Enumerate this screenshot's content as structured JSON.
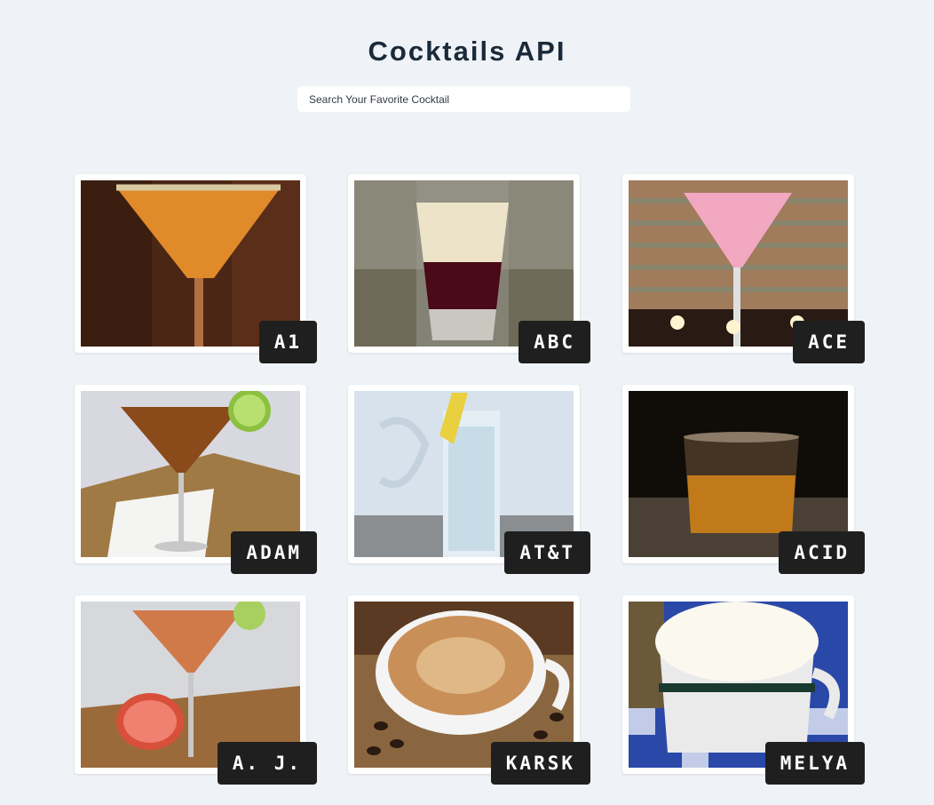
{
  "header": {
    "title": "Cocktails API"
  },
  "search": {
    "placeholder": "Search Your Favorite Cocktail",
    "value": ""
  },
  "cocktails": [
    {
      "name": "A1"
    },
    {
      "name": "ABC"
    },
    {
      "name": "ACE"
    },
    {
      "name": "ADAM"
    },
    {
      "name": "AT&T"
    },
    {
      "name": "ACID"
    },
    {
      "name": "A. J."
    },
    {
      "name": "KARSK"
    },
    {
      "name": "MELYA"
    }
  ],
  "colors": {
    "background": "#eff3f7",
    "label_bg": "#1f1f1f",
    "title": "#1a2a3a"
  }
}
